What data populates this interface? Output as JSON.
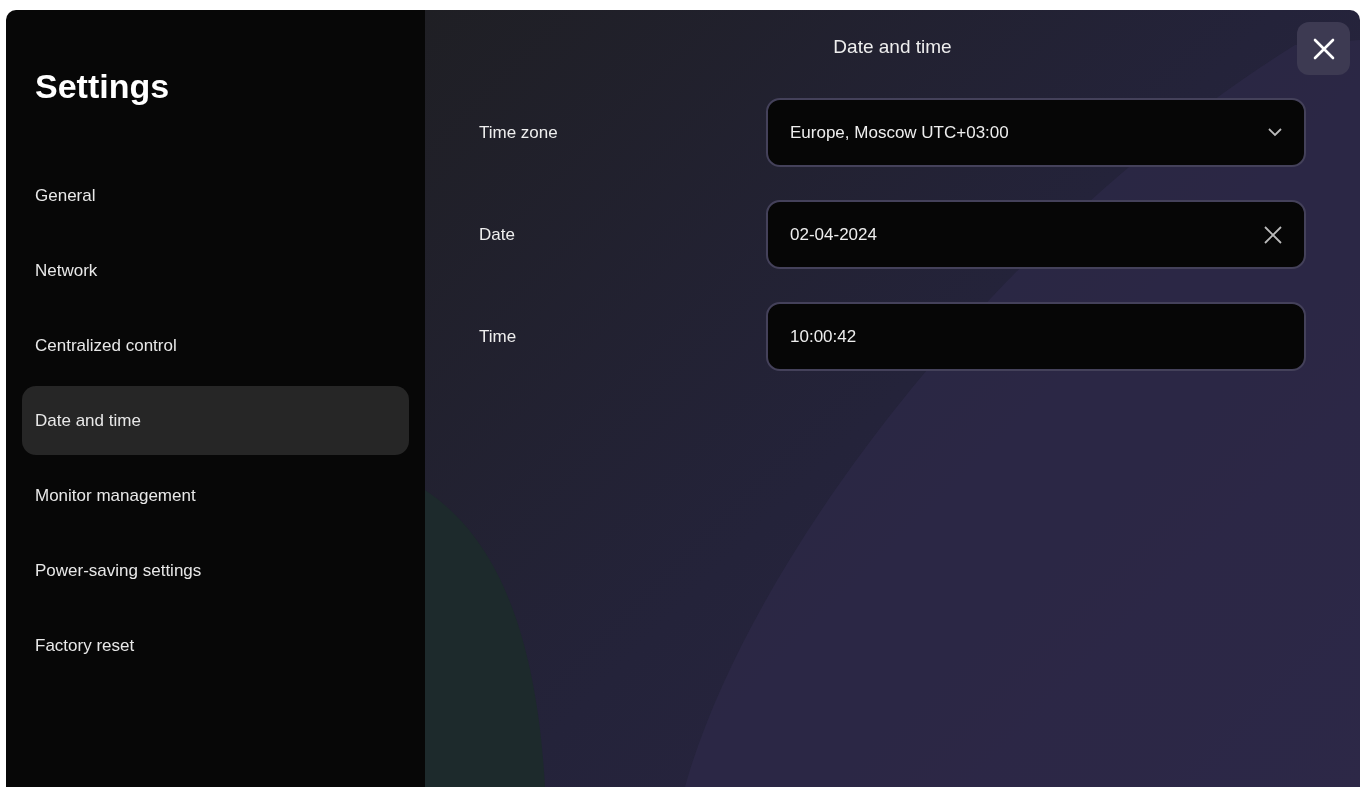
{
  "sidebar": {
    "title": "Settings",
    "items": [
      {
        "label": "General",
        "selected": false
      },
      {
        "label": "Network",
        "selected": false
      },
      {
        "label": "Centralized control",
        "selected": false
      },
      {
        "label": "Date and time",
        "selected": true
      },
      {
        "label": "Monitor management",
        "selected": false
      },
      {
        "label": "Power-saving settings",
        "selected": false
      },
      {
        "label": "Factory reset",
        "selected": false
      }
    ]
  },
  "panel": {
    "title": "Date and time",
    "fields": [
      {
        "label": "Time zone",
        "kind": "select",
        "value": "Europe, Moscow UTC+03:00"
      },
      {
        "label": "Date",
        "kind": "clearable",
        "value": "02-04-2024"
      },
      {
        "label": "Time",
        "kind": "text",
        "value": "10:00:42"
      }
    ]
  }
}
